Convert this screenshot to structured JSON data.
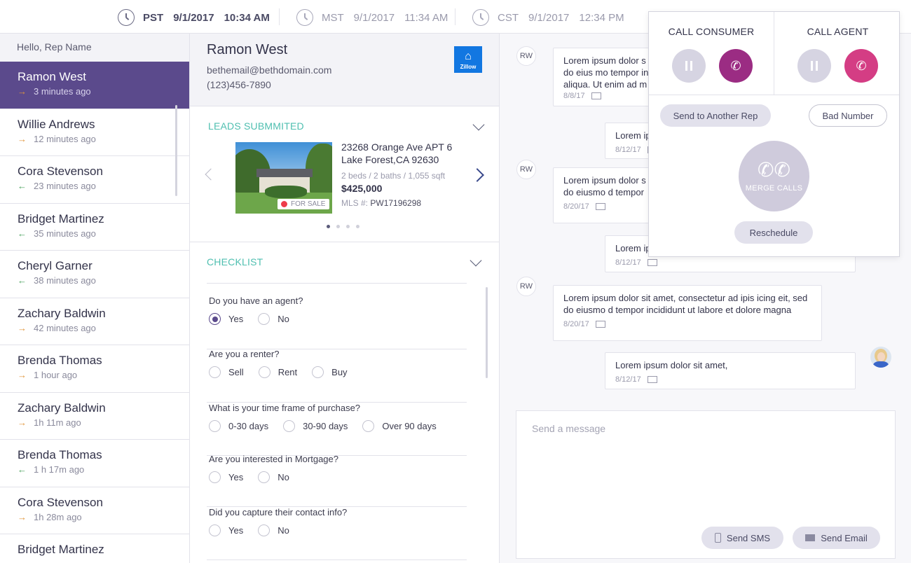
{
  "timezones": [
    {
      "zone": "PST",
      "date": "9/1/2017",
      "time": "10:34 AM"
    },
    {
      "zone": "MST",
      "date": "9/1/2017",
      "time": "11:34 AM"
    },
    {
      "zone": "CST",
      "date": "9/1/2017",
      "time": "12:34 PM"
    }
  ],
  "sidebar": {
    "greeting": "Hello, Rep Name",
    "contacts": [
      {
        "name": "Ramon West",
        "time": "3 minutes ago",
        "direction": "outgoing"
      },
      {
        "name": "Willie Andrews",
        "time": "12 minutes ago",
        "direction": "outgoing"
      },
      {
        "name": "Cora Stevenson",
        "time": "23 minutes ago",
        "direction": "incoming"
      },
      {
        "name": "Bridget Martinez",
        "time": "35 minutes ago",
        "direction": "incoming"
      },
      {
        "name": "Cheryl Garner",
        "time": "38 minutes ago",
        "direction": "incoming"
      },
      {
        "name": "Zachary Baldwin",
        "time": "42 minutes ago",
        "direction": "outgoing"
      },
      {
        "name": "Brenda Thomas",
        "time": "1 hour ago",
        "direction": "outgoing"
      },
      {
        "name": "Zachary Baldwin",
        "time": "1h 11m ago",
        "direction": "outgoing"
      },
      {
        "name": "Brenda Thomas",
        "time": "1 h 17m ago",
        "direction": "incoming"
      },
      {
        "name": "Cora Stevenson",
        "time": "1h 28m ago",
        "direction": "outgoing"
      },
      {
        "name": "Bridget Martinez",
        "time": "",
        "direction": ""
      }
    ]
  },
  "lead": {
    "name": "Ramon West",
    "email": "bethemail@bethdomain.com",
    "phone": "(123)456-7890",
    "source_logo": "Zillow"
  },
  "leads_section": {
    "title": "LEADS SUBMMITED",
    "listing": {
      "address_line1": "23268 Orange Ave APT 6",
      "address_line2": "Lake Forest,CA 92630",
      "beds": "2 beds",
      "baths": "/ 2 baths",
      "sqft": "/ 1,055 sqft",
      "price": "$425,000",
      "mls_label": "MLS #:",
      "mls_value": "PW17196298",
      "status": "FOR SALE"
    },
    "carousel_pages": 4,
    "carousel_active": 1
  },
  "checklist": {
    "title": "CHECKLIST",
    "questions": [
      {
        "text": "Do you have an agent?",
        "options": [
          "Yes",
          "No"
        ],
        "selected": "Yes"
      },
      {
        "text": "Are you a renter?",
        "options": [
          "Sell",
          "Rent",
          "Buy"
        ],
        "selected": ""
      },
      {
        "text": "What is your time frame of purchase?",
        "options": [
          "0-30 days",
          "30-90 days",
          "Over 90 days"
        ],
        "selected": ""
      },
      {
        "text": "Are you interested in Mortgage?",
        "options": [
          "Yes",
          "No"
        ],
        "selected": ""
      },
      {
        "text": "Did you capture their contact info?",
        "options": [
          "Yes",
          "No"
        ],
        "selected": ""
      }
    ]
  },
  "chat": {
    "initials": "RW",
    "messages": [
      {
        "from": "lead",
        "lines": [
          "Lorem ipsum dolor s",
          "do eius mo tempor in",
          "aliqua. Ut enim ad m"
        ],
        "date": "8/8/17",
        "icon": "email-icon"
      },
      {
        "from": "rep",
        "lines": [
          "Lorem ip"
        ],
        "date": "8/12/17",
        "icon": "email-icon"
      },
      {
        "from": "lead",
        "lines": [
          "Lorem ipsum dolor s",
          "do eiusmo d tempor"
        ],
        "date": "8/20/17",
        "icon": "sms-icon"
      },
      {
        "from": "rep",
        "lines": [
          "Lorem ip"
        ],
        "date": "8/12/17",
        "icon": "email-icon"
      },
      {
        "from": "lead",
        "lines": [
          "Lorem ipsum dolor sit amet, consectetur ad ipis icing eit, sed",
          "do eiusmo d tempor incididunt ut labore et dolore magna"
        ],
        "date": "8/20/17",
        "icon": "sms-icon"
      },
      {
        "from": "rep",
        "lines": [
          "Lorem ipsum dolor sit amet,"
        ],
        "date": "8/12/17",
        "icon": "email-icon"
      }
    ],
    "composer_placeholder": "Send a message",
    "send_sms_label": "Send SMS",
    "send_email_label": "Send Email"
  },
  "call_popup": {
    "consumer_title": "CALL CONSUMER",
    "agent_title": "CALL AGENT",
    "send_to_rep_label": "Send to Another Rep",
    "bad_number_label": "Bad Number",
    "merge_label": "MERGE CALLS",
    "reschedule_label": "Reschedule"
  },
  "colors": {
    "accent": "#5b4a8c",
    "teal": "#4fbfb0",
    "call_active": "#9b2c83",
    "call_pink": "#d43d84"
  }
}
